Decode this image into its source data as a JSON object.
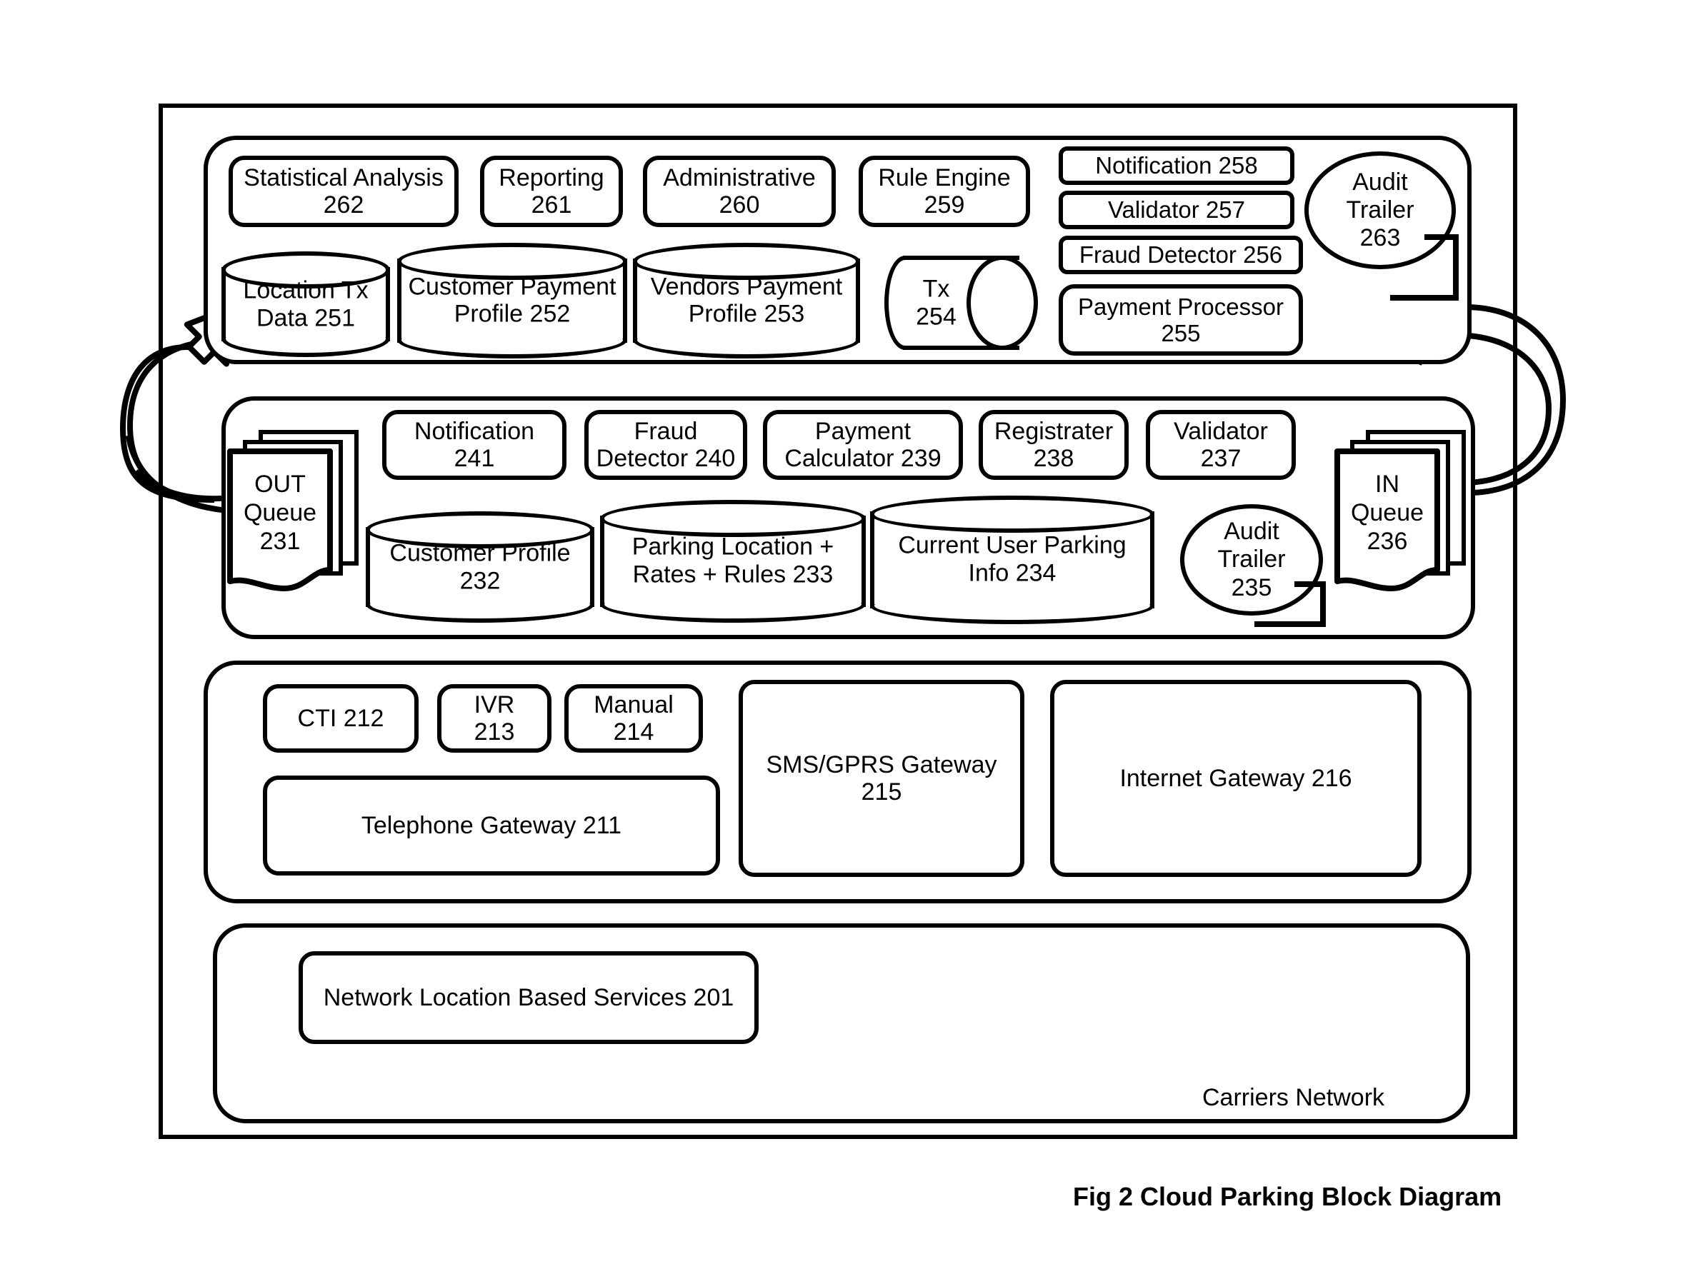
{
  "figure": {
    "caption": "Fig 2 Cloud Parking Block Diagram",
    "carriers_network_label": "Carriers Network"
  },
  "cloud_tier": {
    "modules": [
      {
        "label": "Statistical Analysis 262",
        "line1": "Statistical Analysis",
        "line2": "262"
      },
      {
        "label": "Reporting 261",
        "line1": "Reporting",
        "line2": "261"
      },
      {
        "label": "Administrative 260",
        "line1": "Administrative",
        "line2": "260"
      },
      {
        "label": "Rule Engine 259",
        "line1": "Rule Engine",
        "line2": "259"
      }
    ],
    "services": [
      {
        "label": "Notification 258"
      },
      {
        "label": "Validator 257"
      },
      {
        "label": "Fraud Detector 256"
      },
      {
        "label": "Payment Processor 255",
        "line1": "Payment Processor",
        "line2": "255"
      }
    ],
    "databases": [
      {
        "line1": "Location Tx",
        "line2": "Data 251"
      },
      {
        "line1": "Customer Payment",
        "line2": "Profile 252"
      },
      {
        "line1": "Vendors Payment",
        "line2": "Profile 253"
      }
    ],
    "tx_store": {
      "line1": "Tx",
      "line2": "254"
    },
    "audit_trailer": {
      "line1": "Audit",
      "line2": "Trailer",
      "line3": "263"
    }
  },
  "app_tier": {
    "modules": [
      {
        "line1": "Notification",
        "line2": "241"
      },
      {
        "line1": "Fraud",
        "line2": "Detector 240"
      },
      {
        "line1": "Payment",
        "line2": "Calculator 239"
      },
      {
        "line1": "Registrater",
        "line2": "238"
      },
      {
        "line1": "Validator",
        "line2": "237"
      }
    ],
    "out_queue": {
      "line1": "OUT",
      "line2": "Queue",
      "line3": "231"
    },
    "in_queue": {
      "line1": "IN",
      "line2": "Queue",
      "line3": "236"
    },
    "databases": [
      {
        "line1": "Customer Profile",
        "line2": "232"
      },
      {
        "line1": "Parking Location +",
        "line2": "Rates + Rules   233"
      },
      {
        "line1": "Current User Parking",
        "line2": "Info 234"
      }
    ],
    "audit_trailer": {
      "line1": "Audit",
      "line2": "Trailer",
      "line3": "235"
    }
  },
  "gateway_tier": {
    "channels": [
      {
        "line1": "CTI 212",
        "line2": ""
      },
      {
        "line1": "IVR",
        "line2": "213"
      },
      {
        "line1": "Manual",
        "line2": "214"
      }
    ],
    "telephone_gateway": "Telephone Gateway 211",
    "sms_gprs_gateway": {
      "line1": "SMS/GPRS Gateway",
      "line2": "215"
    },
    "internet_gateway": "Internet Gateway 216"
  },
  "carrier_tier": {
    "network_location_services": "Network Location Based Services 201"
  },
  "colors": {
    "stroke": "#000000",
    "background": "#ffffff"
  }
}
